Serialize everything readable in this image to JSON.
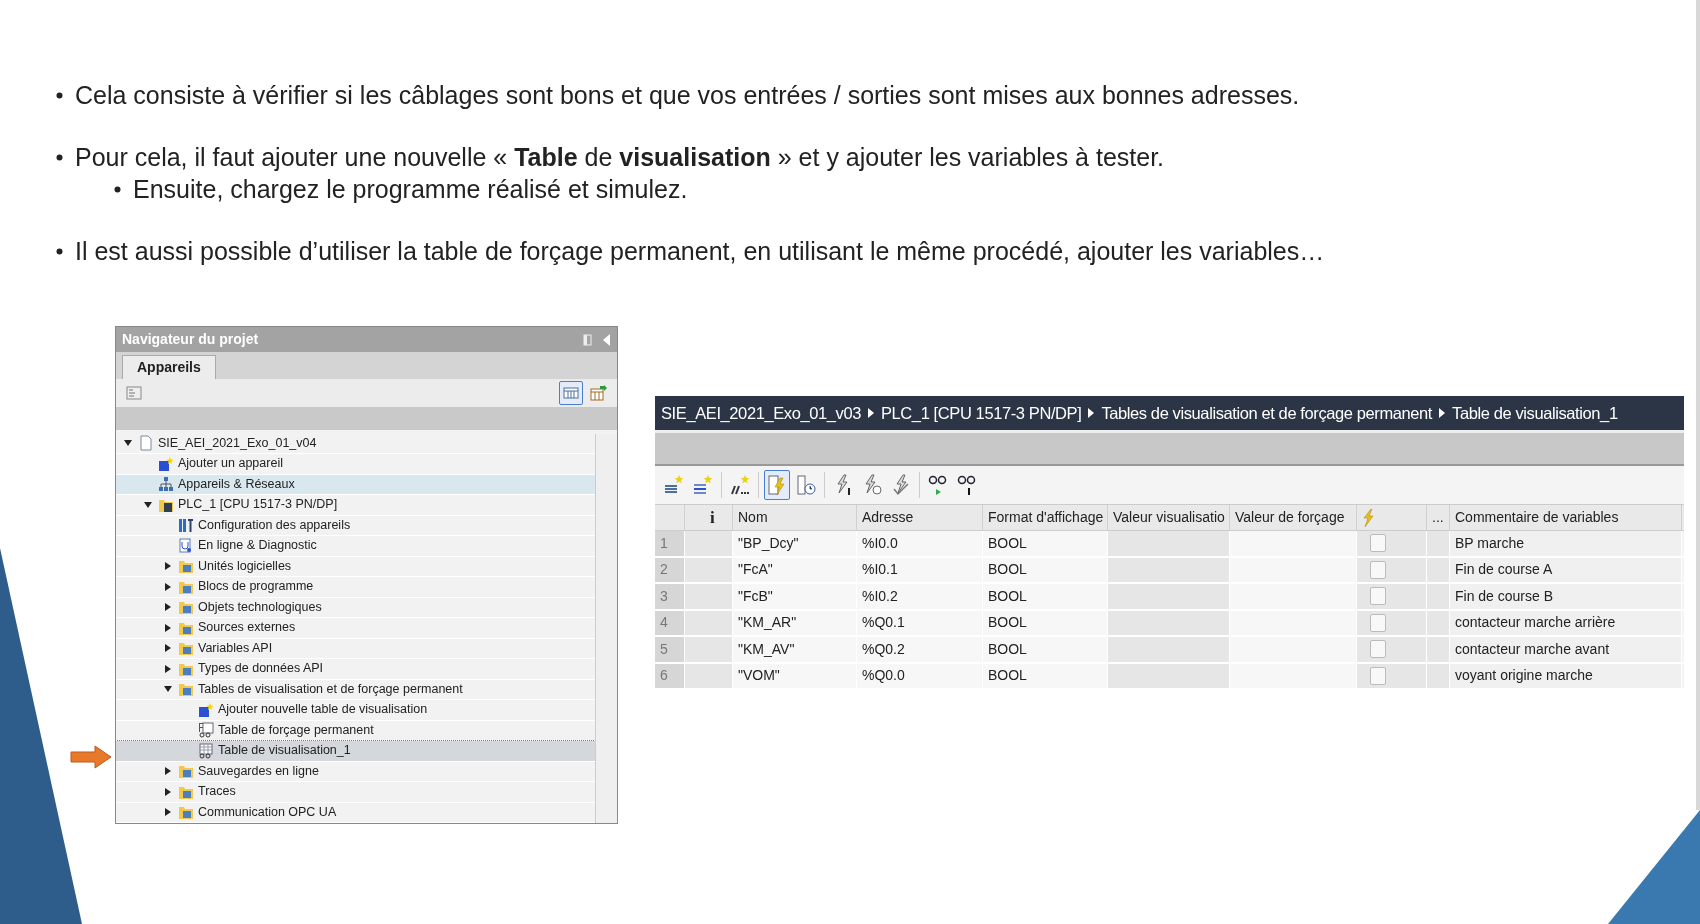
{
  "bullets": [
    {
      "text": "Cela consiste à vérifier si les câblages sont bons et que vos entrées / sorties sont mises aux bonnes adresses."
    },
    {
      "text": "Pour cela, il faut ajouter une nouvelle « **Table** de **visualisation** » et y ajouter les variables à tester.",
      "children": [
        {
          "text": "Ensuite, chargez le programme réalisé et simulez."
        }
      ]
    },
    {
      "text": "Il est aussi possible d’utiliser la table de forçage permanent, en utilisant le même procédé, ajouter les variables…"
    }
  ],
  "navigator": {
    "title": "Navigateur du projet",
    "tabs": [
      {
        "label": "Appareils",
        "selected": true
      }
    ],
    "toolbar": [
      {
        "kind": "overview",
        "selected": false
      },
      {
        "kind": "details",
        "selected": true
      },
      {
        "kind": "export",
        "selected": false
      }
    ],
    "tree": [
      {
        "label": "SIE_AEI_2021_Exo_01_v04",
        "kind": "project",
        "expanded": true,
        "selected": false,
        "hovered": false,
        "children": [
          {
            "label": "Ajouter un appareil",
            "kind": "add",
            "selected": false,
            "hovered": false
          },
          {
            "label": "Appareils & Réseaux",
            "kind": "network",
            "selected": false,
            "hovered": true
          },
          {
            "label": "PLC_1 [CPU 1517-3 PN/DP]",
            "kind": "plc",
            "expanded": true,
            "selected": false,
            "hovered": false,
            "children": [
              {
                "label": "Configuration des appareils",
                "kind": "config",
                "selected": false,
                "hovered": false
              },
              {
                "label": "En ligne & Diagnostic",
                "kind": "diagnostic",
                "selected": false,
                "hovered": false
              },
              {
                "label": "Unités logicielles",
                "kind": "folder",
                "expanded": false,
                "selected": false,
                "hovered": false
              },
              {
                "label": "Blocs de programme",
                "kind": "folder",
                "expanded": false,
                "selected": false,
                "hovered": false
              },
              {
                "label": "Objets technologiques",
                "kind": "folder",
                "expanded": false,
                "selected": false,
                "hovered": false
              },
              {
                "label": "Sources externes",
                "kind": "folder",
                "expanded": false,
                "selected": false,
                "hovered": false
              },
              {
                "label": "Variables API",
                "kind": "folder",
                "expanded": false,
                "selected": false,
                "hovered": false
              },
              {
                "label": "Types de données API",
                "kind": "folder",
                "expanded": false,
                "selected": false,
                "hovered": false
              },
              {
                "label": "Tables de visualisation et de forçage permanent",
                "kind": "folder",
                "expanded": true,
                "selected": false,
                "hovered": false,
                "children": [
                  {
                    "label": "Ajouter nouvelle table de visualisation",
                    "kind": "add",
                    "selected": false,
                    "hovered": false
                  },
                  {
                    "label": "Table de forçage permanent",
                    "kind": "force-table",
                    "selected": false,
                    "hovered": false
                  },
                  {
                    "label": "Table de visualisation_1",
                    "kind": "watch-table",
                    "selected": true,
                    "hovered": false
                  }
                ]
              },
              {
                "label": "Sauvegardes en ligne",
                "kind": "folder",
                "expanded": false,
                "selected": false,
                "hovered": false
              },
              {
                "label": "Traces",
                "kind": "folder",
                "expanded": false,
                "selected": false,
                "hovered": false
              },
              {
                "label": "Communication OPC UA",
                "kind": "folder",
                "expanded": false,
                "selected": false,
                "hovered": false
              }
            ]
          }
        ]
      }
    ]
  },
  "watch_table": {
    "breadcrumb": [
      "SIE_AEI_2021_Exo_01_v03",
      "PLC_1 [CPU 1517-3 PN/DP]",
      "Tables de visualisation et de forçage permanent",
      "Table de visualisation_1"
    ],
    "toolbar": [
      {
        "kind": "add-row",
        "selected": false
      },
      {
        "kind": "insert-row",
        "selected": false
      },
      {
        "kind": "add-rows",
        "selected": false
      },
      {
        "kind": "monitor",
        "selected": true
      },
      {
        "kind": "monitor-timed",
        "selected": false
      },
      {
        "kind": "modify",
        "selected": false
      },
      {
        "kind": "modify-timed",
        "selected": false
      },
      {
        "kind": "modify-all",
        "selected": false
      },
      {
        "kind": "glasses-play",
        "selected": false
      },
      {
        "kind": "glasses-one",
        "selected": false
      }
    ],
    "columns": [
      {
        "kind": "index"
      },
      {
        "kind": "text",
        "label": "i"
      },
      {
        "kind": "text",
        "label": "Nom"
      },
      {
        "kind": "text",
        "label": "Adresse"
      },
      {
        "kind": "text",
        "label": "Format d'affichage"
      },
      {
        "kind": "text",
        "label": "Valeur visualisatio"
      },
      {
        "kind": "text",
        "label": "Valeur de forçage"
      },
      {
        "kind": "icon"
      },
      {
        "kind": "text",
        "label": "..."
      },
      {
        "kind": "text",
        "label": "Commentaire de variables"
      }
    ],
    "rows": [
      {
        "index": "1",
        "name": "\"BP_Dcy\"",
        "address": "%I0.0",
        "format": "BOOL",
        "checked": false,
        "comment": "BP marche"
      },
      {
        "index": "2",
        "name": "\"FcA\"",
        "address": "%I0.1",
        "format": "BOOL",
        "checked": false,
        "comment": "Fin de course A"
      },
      {
        "index": "3",
        "name": "\"FcB\"",
        "address": "%I0.2",
        "format": "BOOL",
        "checked": false,
        "comment": "Fin de course B"
      },
      {
        "index": "4",
        "name": "\"KM_AR\"",
        "address": "%Q0.1",
        "format": "BOOL",
        "checked": false,
        "comment": "contacteur marche arrière"
      },
      {
        "index": "5",
        "name": "\"KM_AV\"",
        "address": "%Q0.2",
        "format": "BOOL",
        "checked": false,
        "comment": "contacteur marche avant"
      },
      {
        "index": "6",
        "name": "\"VOM\"",
        "address": "%Q0.0",
        "format": "BOOL",
        "checked": false,
        "comment": "voyant origine marche"
      }
    ]
  }
}
